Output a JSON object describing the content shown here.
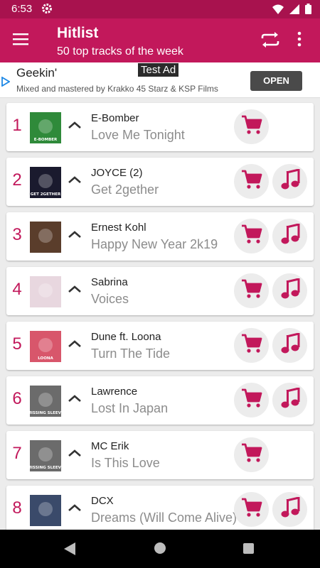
{
  "status_bar": {
    "time": "6:53"
  },
  "app_bar": {
    "title": "Hitlist",
    "subtitle": "50 top tracks of the week"
  },
  "ad": {
    "tag": "Test Ad",
    "title": "Geekin'",
    "description": "Mixed and mastered by Krakko 45 Starz & KSP Films",
    "button": "OPEN"
  },
  "colors": {
    "accent": "#c2185b",
    "status_bar": "#a8124e",
    "background": "#ececec"
  },
  "tracks": [
    {
      "rank": "1",
      "artist": "E-Bomber",
      "title": "Love Me Tonight",
      "has_music": false,
      "cover_color": "#2f8a3a",
      "cover_text": "E-BOMBER"
    },
    {
      "rank": "2",
      "artist": "JOYCE (2)",
      "title": "Get 2gether",
      "has_music": true,
      "cover_color": "#1a1a2e",
      "cover_text": "GET 2GETHER"
    },
    {
      "rank": "3",
      "artist": "Ernest Kohl",
      "title": "Happy New Year 2k19",
      "has_music": true,
      "cover_color": "#5a3d2b",
      "cover_text": ""
    },
    {
      "rank": "4",
      "artist": "Sabrina",
      "title": "Voices",
      "has_music": true,
      "cover_color": "#e8d7df",
      "cover_text": ""
    },
    {
      "rank": "5",
      "artist": "Dune ft. Loona",
      "title": "Turn The Tide",
      "has_music": true,
      "cover_color": "#d8566b",
      "cover_text": "LOONA"
    },
    {
      "rank": "6",
      "artist": "Lawrence",
      "title": "Lost In Japan",
      "has_music": true,
      "cover_color": "#6b6b6b",
      "cover_text": "MISSING SLEEVE"
    },
    {
      "rank": "7",
      "artist": "MC Erik",
      "title": "Is This Love",
      "has_music": false,
      "cover_color": "#6b6b6b",
      "cover_text": "MISSING SLEEVE"
    },
    {
      "rank": "8",
      "artist": "DCX",
      "title": "Dreams (Will Come Alive)",
      "has_music": true,
      "cover_color": "#3a4a6a",
      "cover_text": ""
    }
  ]
}
